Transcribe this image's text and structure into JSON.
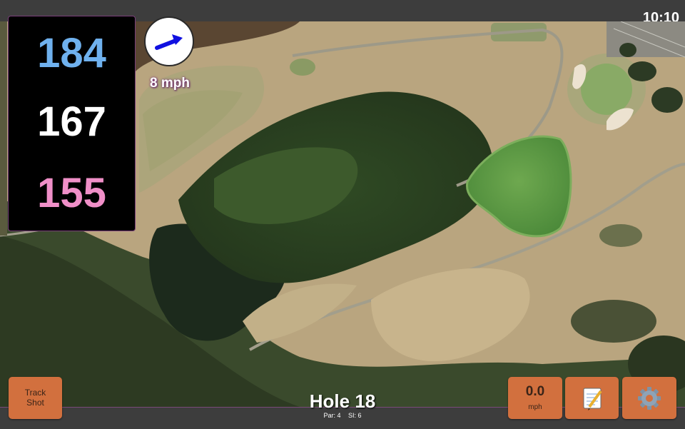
{
  "clock": "10:10",
  "distances": {
    "back": "184",
    "middle": "167",
    "front": "155"
  },
  "wind": {
    "speed": "8 mph",
    "icon": "wind-direction-arrow-icon"
  },
  "hole": {
    "title": "Hole 18",
    "par": "Par: 4",
    "si": "SI: 6"
  },
  "buttons": {
    "track_shot": "Track Shot",
    "speed_value": "0.0",
    "speed_unit": "mph",
    "notes_icon": "notepad-icon",
    "settings_icon": "gear-icon"
  },
  "colors": {
    "back": "#6fb1ee",
    "middle": "#ffffff",
    "front": "#f08fc8",
    "button": "#d2703e",
    "wind_arrow": "#1010e0"
  }
}
